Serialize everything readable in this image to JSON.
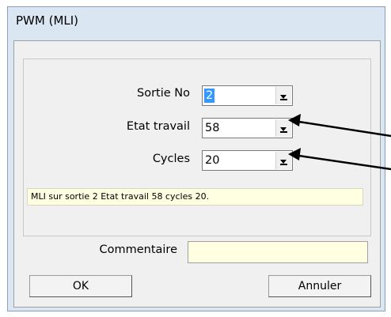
{
  "window": {
    "title": "PWM (MLI)"
  },
  "fields": {
    "sortie": {
      "label": "Sortie No",
      "value": "2"
    },
    "etat": {
      "label": "Etat travail",
      "value": "58"
    },
    "cycles": {
      "label": "Cycles",
      "value": "20"
    }
  },
  "summary": "MLI sur sortie 2 Etat travail 58 cycles 20.",
  "comment": {
    "label": "Commentaire",
    "value": ""
  },
  "buttons": {
    "ok": "OK",
    "cancel": "Annuler"
  },
  "icons": {
    "dropdown": "chevron-down-icon",
    "annotation": "arrow-left-icon"
  }
}
